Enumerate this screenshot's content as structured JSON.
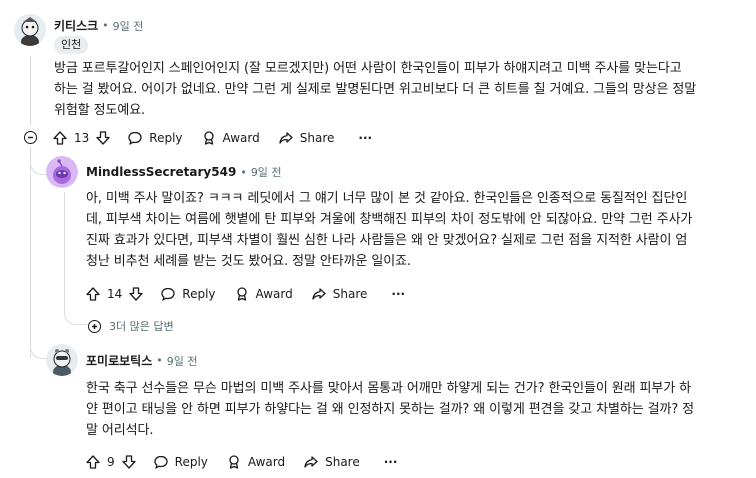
{
  "comments": [
    {
      "username": "키티스크",
      "age": "9일 전",
      "flair": "인천",
      "body_line1": "방금 포르투갈어인지 스페인어인지 (잘 모르겠지만) 어떤 사람이 한국인들이 피부가 하얘지려고 미백 주사를 맞는다고",
      "body_line2": "하는 걸 봤어요. 어이가 없네요. 만약 그런 게 실제로 발명된다면 위고비보다 더 큰 히트를 칠 거예요. 그들의 망상은 정말",
      "body_line3": "위험할 정도예요.",
      "votes": "13",
      "reply": "Reply",
      "award": "Award",
      "share": "Share",
      "more": "···"
    },
    {
      "username": "MindlessSecretary549",
      "age": "9일 전",
      "body_line1": "아, 미백 주사 말이죠? ㅋㅋㅋ 레딧에서 그 얘기 너무 많이 본 것 같아요. 한국인들은 인종적으로 동질적인 집단인",
      "body_line2": "데, 피부색 차이는 여름에 햇볕에 탄 피부와 겨울에 창백해진 피부의 차이 정도밖에 안 되잖아요. 만약 그런 주사가",
      "body_line3": "진짜 효과가 있다면, 피부색 차별이 훨씬 심한 나라 사람들은 왜 안 맞겠어요? 실제로 그런 점을 지적한 사람이 엄",
      "body_line4": "청난 비추천 세례를 받는 것도 봤어요. 정말 안타까운 일이죠.",
      "votes": "14",
      "reply": "Reply",
      "award": "Award",
      "share": "Share",
      "more": "···",
      "more_replies": "3더 많은 답변"
    },
    {
      "username": "포미로보틱스",
      "age": "9일 전",
      "body_line1": "한국 축구 선수들은 무슨 마법의 미백 주사를 맞아서 몸통과 어깨만 하얗게 되는 건가? 한국인들이 원래 피부가 하",
      "body_line2": "얀 편이고 태닝을 안 하면 피부가 하얗다는 걸 왜 인정하지 못하는 걸까? 왜 이렇게 편견을 갖고 차별하는 걸까? 정",
      "body_line3": "말 어리석다.",
      "votes": "9",
      "reply": "Reply",
      "award": "Award",
      "share": "Share",
      "more": "···"
    }
  ],
  "separator": "•",
  "icons": [
    "upvote-icon",
    "downvote-icon",
    "reply-icon",
    "award-icon",
    "share-icon",
    "collapse-icon",
    "expand-icon"
  ],
  "colors": {
    "text": "#1a1a1b",
    "meta": "#576f76",
    "line": "#d9dde0",
    "avatar3": "#6a5acd"
  }
}
